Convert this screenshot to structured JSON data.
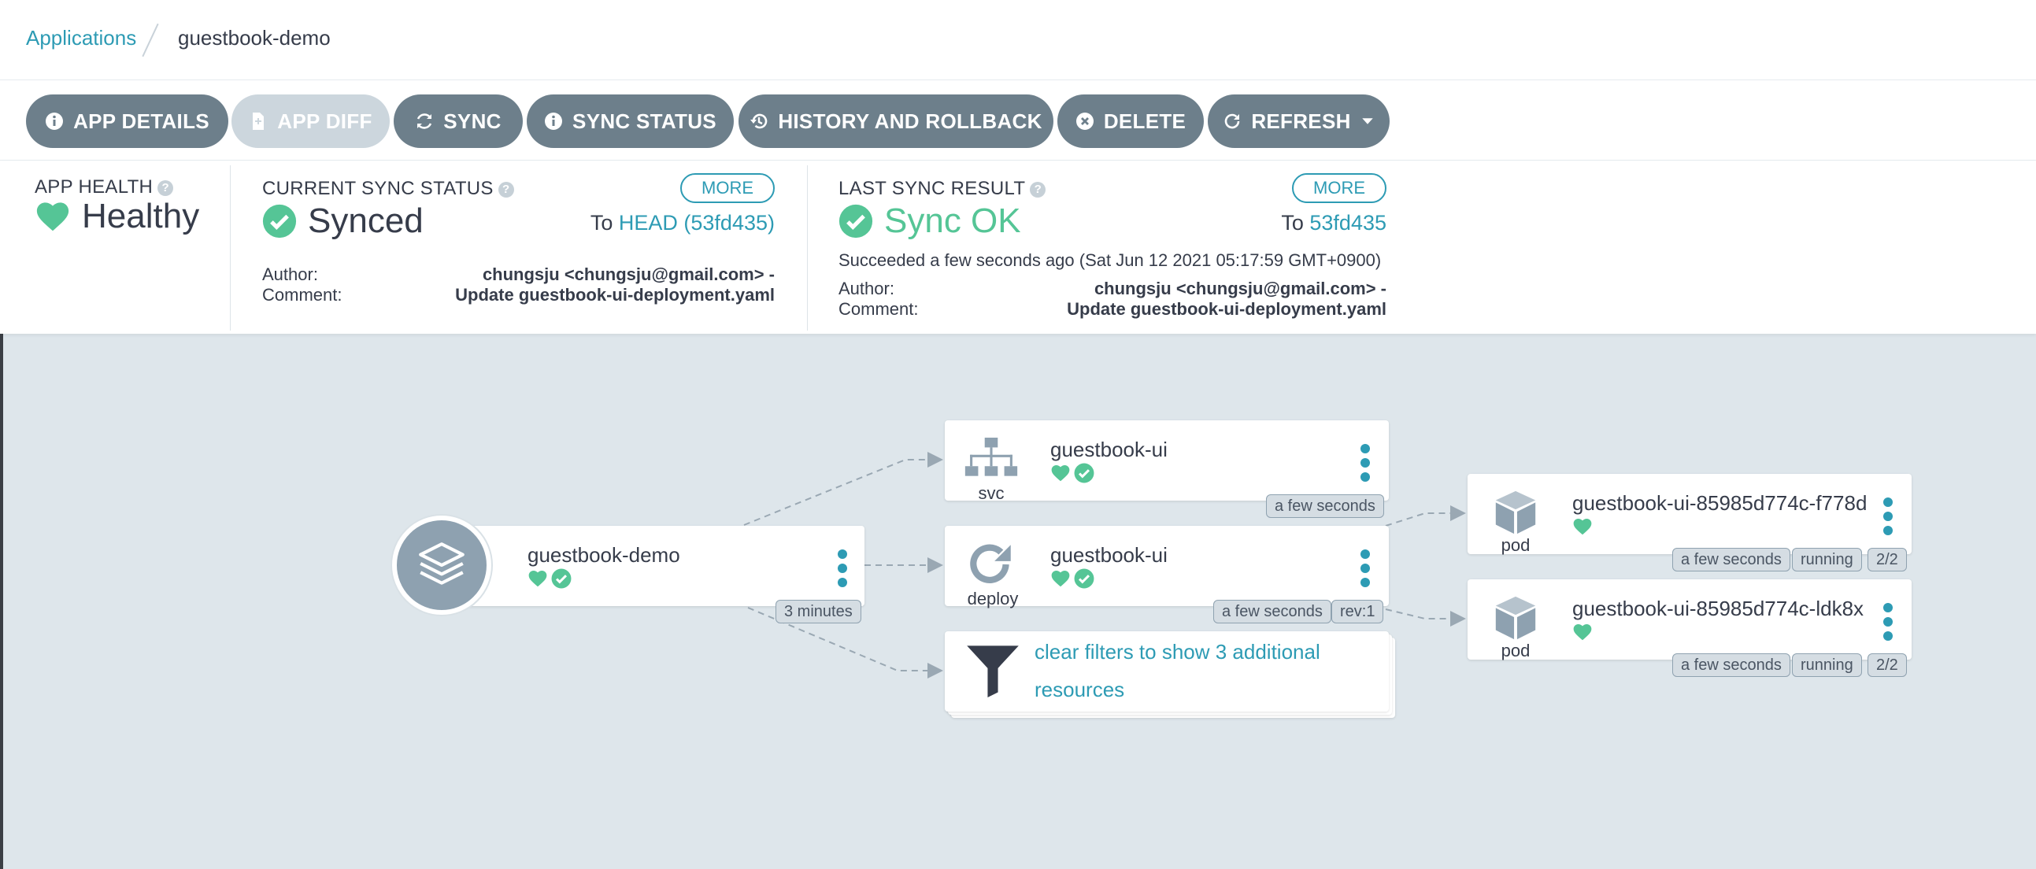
{
  "breadcrumb": {
    "root": "Applications",
    "current": "guestbook-demo"
  },
  "toolbar": {
    "app_details": "APP DETAILS",
    "app_diff": "APP DIFF",
    "sync": "SYNC",
    "sync_status": "SYNC STATUS",
    "history": "HISTORY AND ROLLBACK",
    "delete": "DELETE",
    "refresh": "REFRESH"
  },
  "health": {
    "label": "APP HEALTH",
    "value": "Healthy"
  },
  "sync_status": {
    "label": "CURRENT SYNC STATUS",
    "value": "Synced",
    "more": "MORE",
    "to_prefix": "To",
    "to_ref": "HEAD (53fd435)",
    "author_label": "Author:",
    "author": "chungsju <chungsju@gmail.com> -",
    "comment_label": "Comment:",
    "comment": "Update guestbook-ui-deployment.yaml"
  },
  "last_sync": {
    "label": "LAST SYNC RESULT",
    "value": "Sync OK",
    "more": "MORE",
    "to_prefix": "To",
    "to_ref": "53fd435",
    "succeeded": "Succeeded a few seconds ago (Sat Jun 12 2021 05:17:59 GMT+0900)",
    "author_label": "Author:",
    "author": "chungsju <chungsju@gmail.com> -",
    "comment_label": "Comment:",
    "comment": "Update guestbook-ui-deployment.yaml"
  },
  "graph": {
    "app": {
      "name": "guestbook-demo",
      "age": "3 minutes"
    },
    "svc": {
      "name": "guestbook-ui",
      "kind": "svc",
      "age": "a few seconds"
    },
    "deploy": {
      "name": "guestbook-ui",
      "kind": "deploy",
      "age": "a few seconds",
      "rev": "rev:1"
    },
    "filter": {
      "text": "clear filters to show 3 additional resources"
    },
    "pods": [
      {
        "name": "guestbook-ui-85985d774c-f778d",
        "kind": "pod",
        "age": "a few seconds",
        "status": "running",
        "ready": "2/2"
      },
      {
        "name": "guestbook-ui-85985d774c-ldk8x",
        "kind": "pod",
        "age": "a few seconds",
        "status": "running",
        "ready": "2/2"
      }
    ]
  },
  "colors": {
    "accent": "#2d9bb4",
    "healthy": "#55c596",
    "button": "#6d7f8b",
    "canvas": "#dee6eb"
  }
}
